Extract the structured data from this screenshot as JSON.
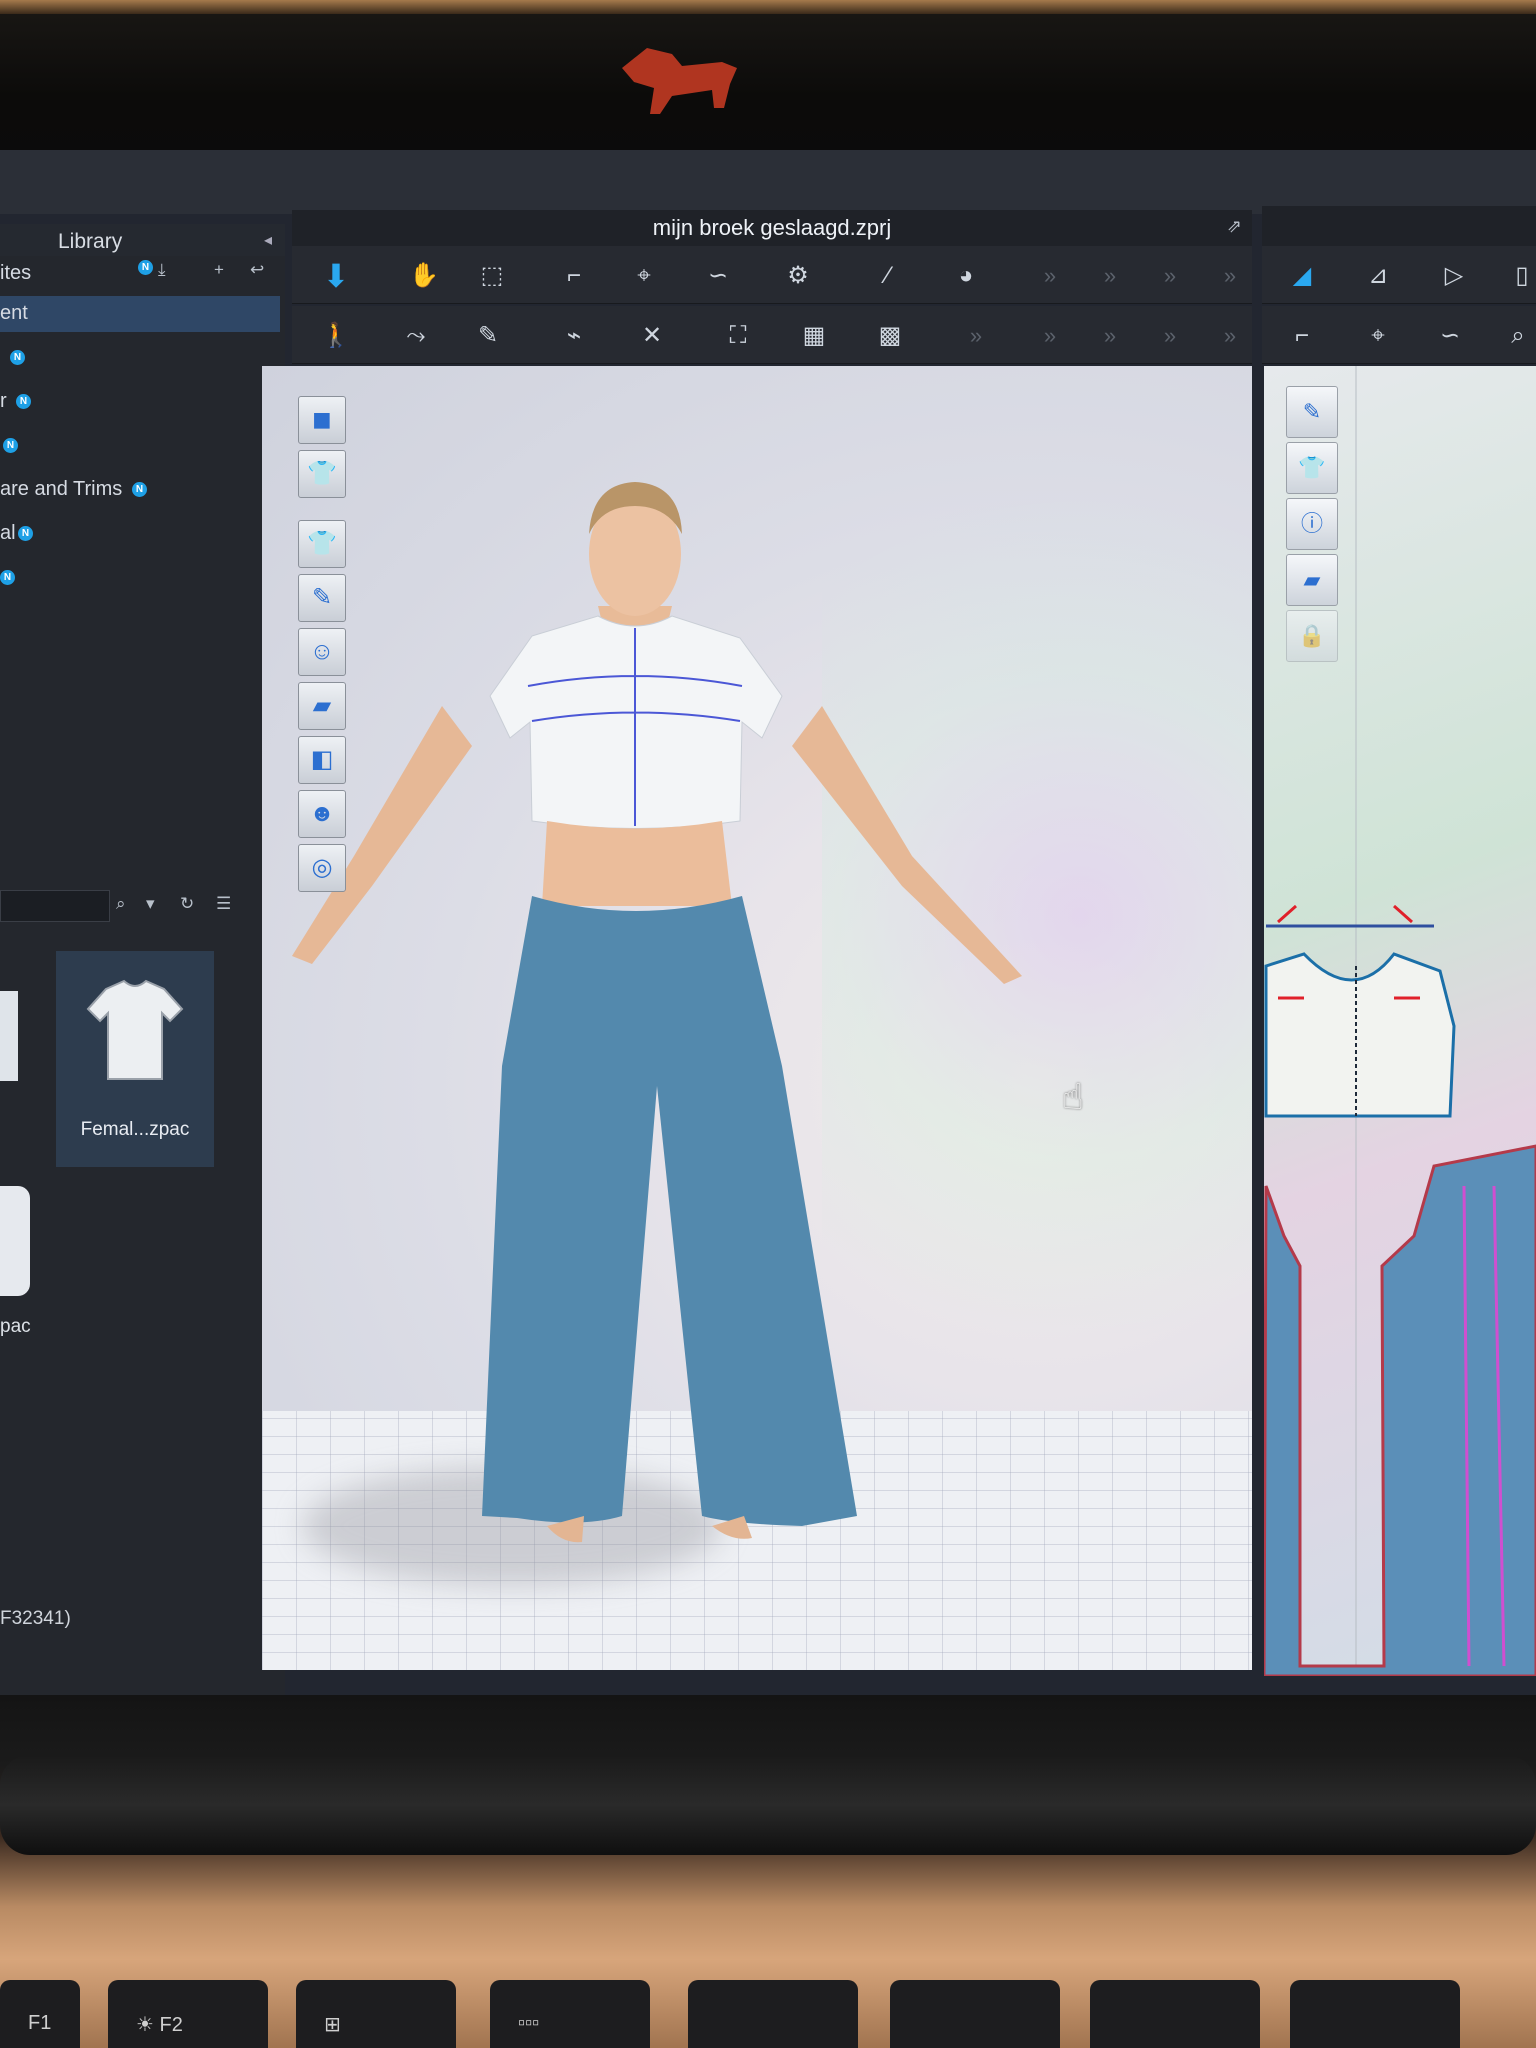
{
  "window": {
    "title": "mijn broek geslaagd.zprj"
  },
  "library": {
    "title": "Library",
    "items": [
      {
        "label": "ites",
        "badge": "N"
      },
      {
        "label": "ent",
        "badge": ""
      },
      {
        "label": "",
        "badge": "N"
      },
      {
        "label": "r",
        "badge": "N"
      },
      {
        "label": "",
        "badge": "N"
      },
      {
        "label": "are and Trims",
        "badge": "N"
      },
      {
        "label": "al",
        "badge": "N"
      },
      {
        "label": "",
        "badge": "N"
      }
    ],
    "thumbnails": [
      {
        "label": "Femal...zpac"
      },
      {
        "label": "pac"
      }
    ]
  },
  "status_bar": {
    "text": "F32341)"
  },
  "colors": {
    "accent": "#1ea0e6",
    "selection": "#2f4766",
    "garment_pants": "#5389ad",
    "garment_top": "#f2f4f6"
  },
  "icons": {
    "toolbar_row1": [
      "select-mesh-icon",
      "transform-pattern-icon",
      "select-box-icon",
      "edit-pattern-icon",
      "edit-point-icon",
      "edit-curve-icon",
      "sewing-icon",
      "pin-icon",
      "fold-icon"
    ],
    "toolbar_row2": [
      "avatar-pose-icon",
      "segment-sewing-icon",
      "free-sewing-icon",
      "check-sewing-icon",
      "tack-icon",
      "sewing-garment-icon",
      "texture-garment-icon",
      "fabric-garment-icon"
    ],
    "viewport_tools": [
      "3d-view-icon",
      "garment-view-icon",
      "show-garment-icon",
      "show-avatar-pattern-icon",
      "show-avatar-icon",
      "show-fabric-icon",
      "show-shader-icon",
      "avatar-icon",
      "environment-icon"
    ],
    "pattern_tools": [
      "show-edge-icon",
      "show-garment-2d-icon",
      "info-icon",
      "fabric-2d-icon",
      "lock-icon"
    ]
  }
}
